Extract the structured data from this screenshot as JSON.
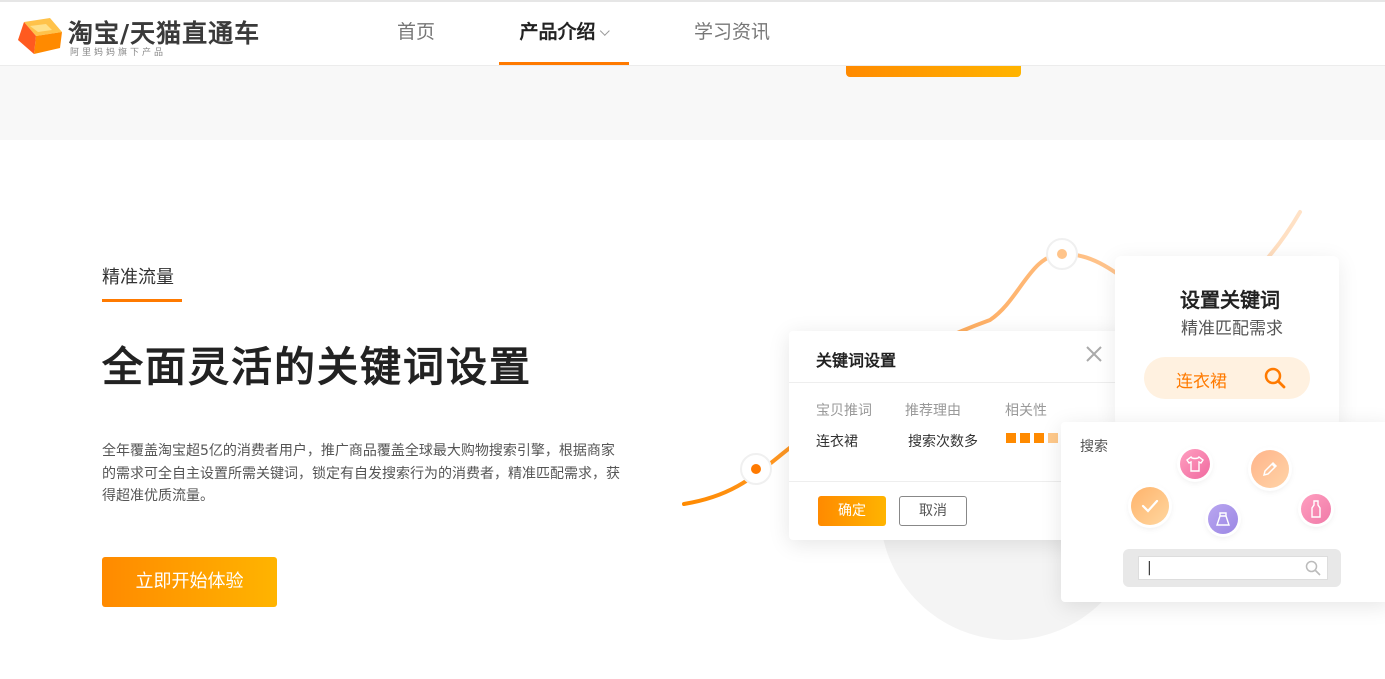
{
  "header": {
    "logo_title": "淘宝/天猫直通车",
    "logo_sub": "阿里妈妈旗下产品",
    "nav": {
      "home": "首页",
      "product": "产品介绍",
      "learn": "学习资讯"
    }
  },
  "hero": {
    "tag": "精准流量",
    "headline": "全面灵活的关键词设置",
    "desc": "全年覆盖淘宝超5亿的消费者用户，推广商品覆盖全球最大购物搜索引擎，根据商家的需求可全自主设置所需关键词，锁定有自发搜索行为的消费者，精准匹配需求，获得超准优质流量。",
    "cta": "立即开始体验"
  },
  "keyword_dialog": {
    "title": "关键词设置",
    "columns": [
      "宝贝推词",
      "推荐理由",
      "相关性"
    ],
    "row": {
      "word": "连衣裙",
      "reason": "搜索次数多",
      "relevance": 3.5,
      "relevance_max": 4
    },
    "ok": "确定",
    "cancel": "取消"
  },
  "set_card": {
    "title": "设置关键词",
    "subtitle": "精准匹配需求",
    "pill": "连衣裙"
  },
  "search_card": {
    "label": "搜索",
    "input_value": "|",
    "icons": [
      "shirt-icon",
      "pencil-icon",
      "check-icon",
      "skirt-icon",
      "bottle-icon"
    ]
  },
  "colors": {
    "accent": "#ff7a00",
    "accent_end": "#ffb400",
    "text": "#333333",
    "band": "#f8f8f8"
  }
}
